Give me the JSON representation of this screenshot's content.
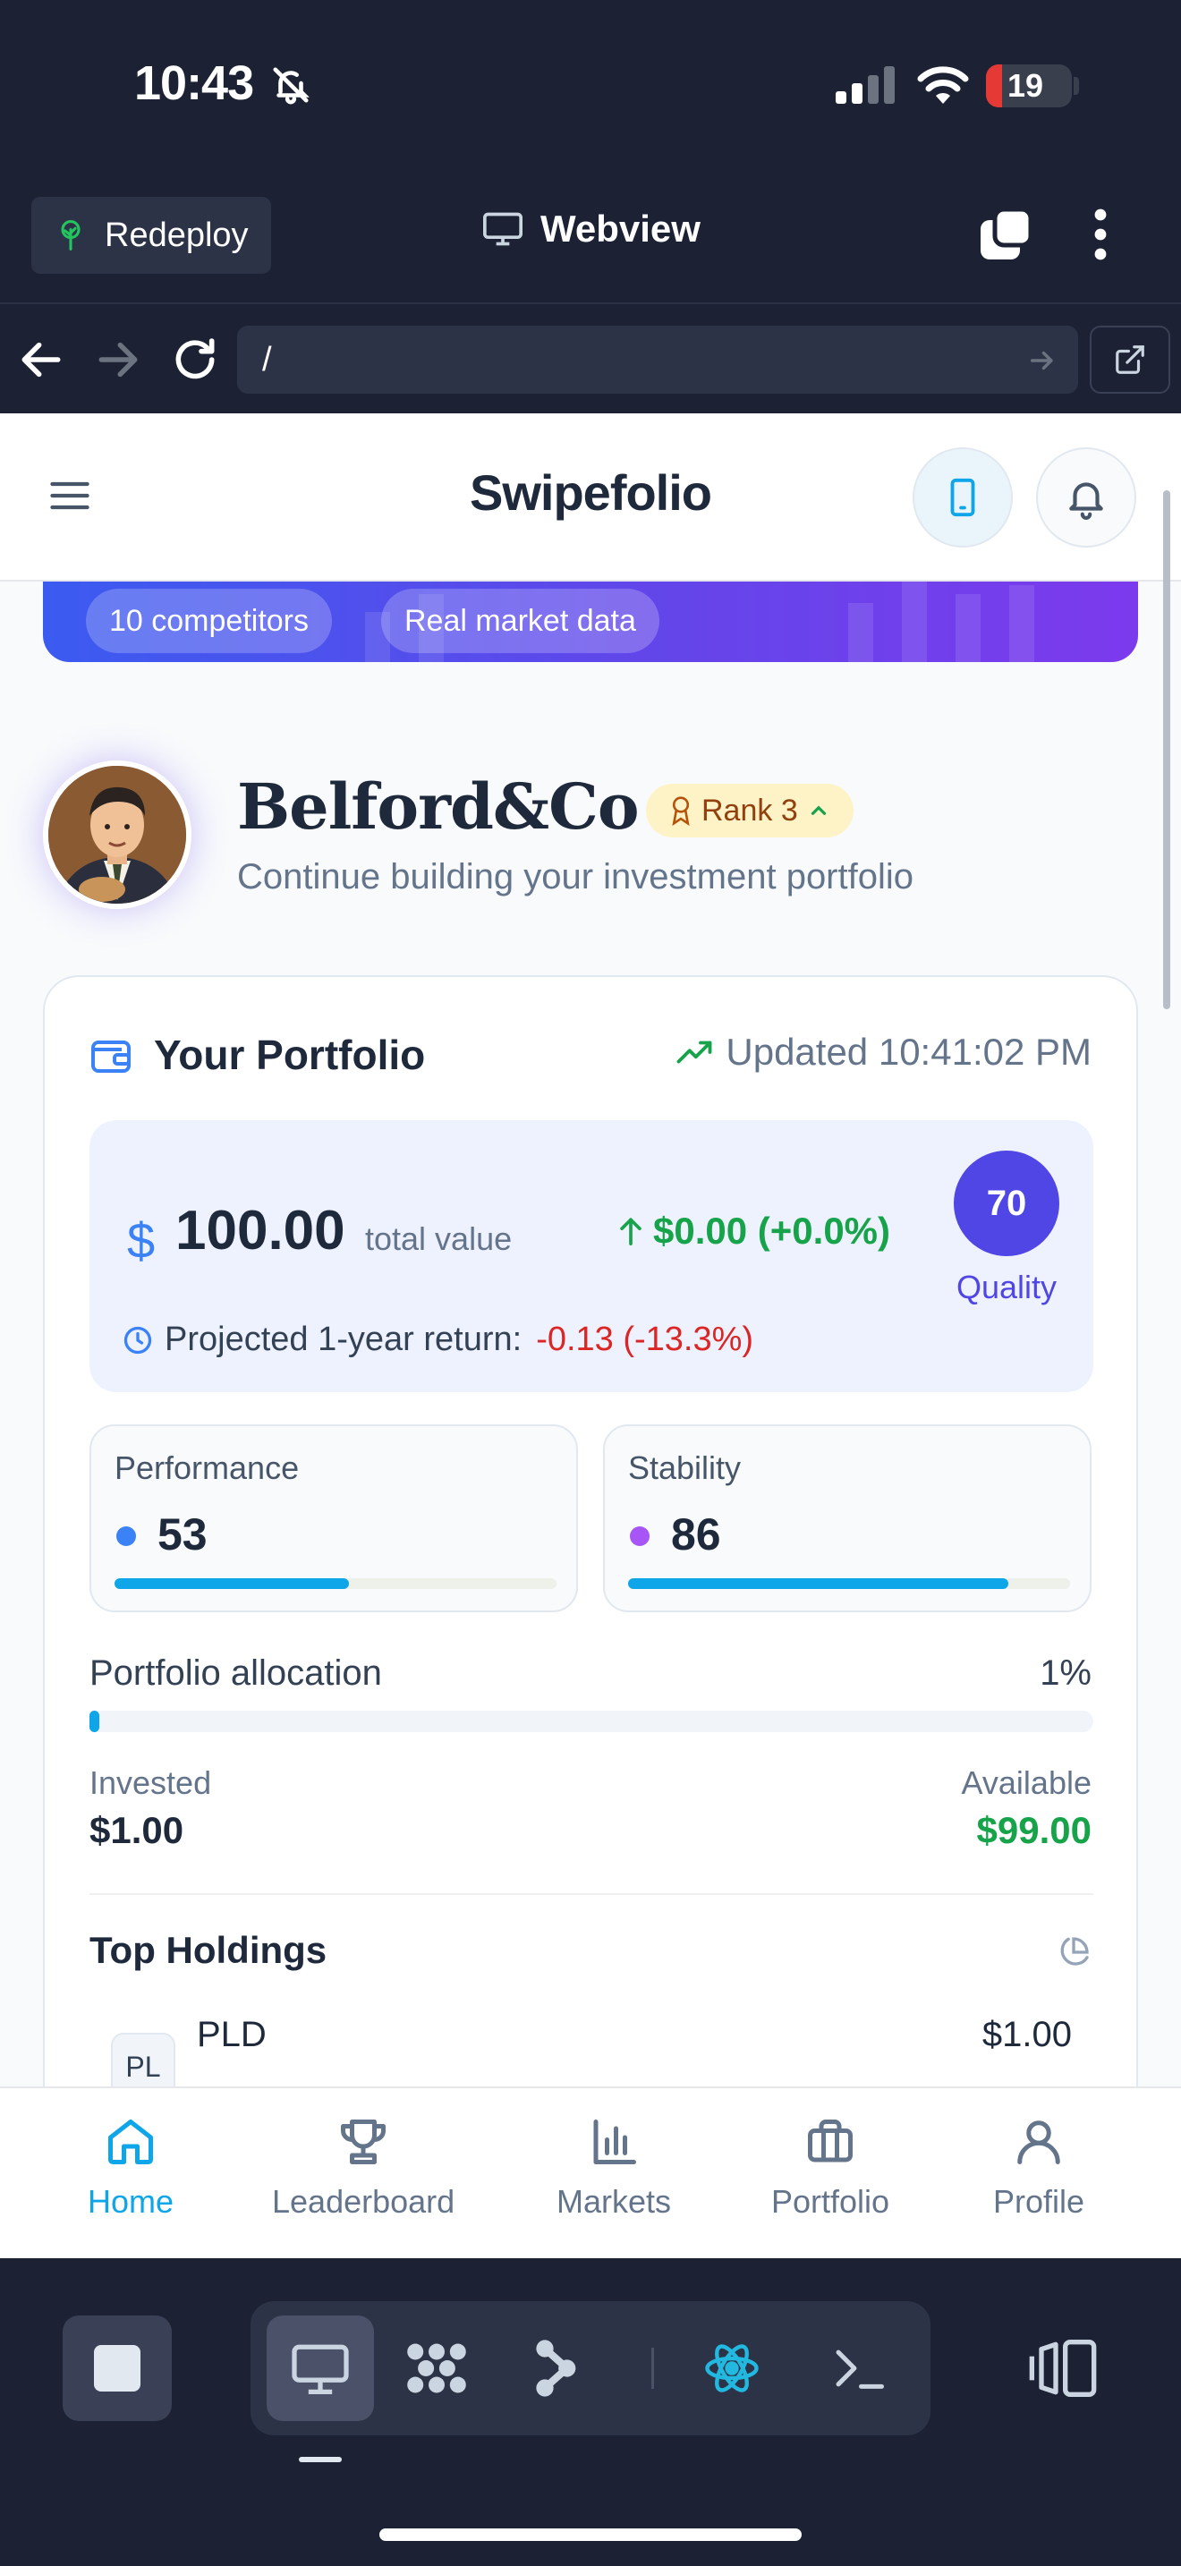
{
  "status_bar": {
    "time": "10:43",
    "battery": "19",
    "battery_level_pct": 19
  },
  "ide": {
    "redeploy_label": "Redeploy",
    "webview_label": "Webview"
  },
  "url_bar": {
    "url": "/"
  },
  "app": {
    "brand": "Swipefolio",
    "hero_chips": [
      "10 competitors",
      "Real market data"
    ],
    "user": {
      "name": "Belford&Co",
      "rank": "Rank 3",
      "subtitle": "Continue building your investment portfolio"
    },
    "portfolio": {
      "title": "Your Portfolio",
      "updated": "Updated 10:41:02 PM",
      "currency_symbol": "$",
      "total_value": "100.00",
      "total_label": "total value",
      "change": "$0.00 (+0.0%)",
      "quality_score": "70",
      "quality_label": "Quality",
      "projected_label": "Projected 1-year return:",
      "projected_value": "-0.13 (-13.3%)",
      "metrics": [
        {
          "label": "Performance",
          "value": "53",
          "dot_color": "#3b82f6",
          "bar_fraction": 0.53
        },
        {
          "label": "Stability",
          "value": "86",
          "dot_color": "#a855f7",
          "bar_fraction": 0.86
        }
      ],
      "allocation_label": "Portfolio allocation",
      "allocation_pct": "1%",
      "allocation_fraction": 0.01,
      "invested_label": "Invested",
      "invested_value": "$1.00",
      "available_label": "Available",
      "available_value": "$99.00",
      "holdings_title": "Top Holdings",
      "holdings": [
        {
          "badge": "PL",
          "symbol": "PLD",
          "value": "$1.00"
        }
      ]
    },
    "bottom_nav": [
      {
        "label": "Home",
        "icon": "home-icon",
        "active": true
      },
      {
        "label": "Leaderboard",
        "icon": "trophy-icon",
        "active": false
      },
      {
        "label": "Markets",
        "icon": "bar-chart-icon",
        "active": false
      },
      {
        "label": "Portfolio",
        "icon": "briefcase-icon",
        "active": false
      },
      {
        "label": "Profile",
        "icon": "user-icon",
        "active": false
      }
    ]
  },
  "colors": {
    "accent": "#0ea5e9",
    "brand_indigo": "#4f46e5",
    "positive": "#16a34a",
    "negative": "#dc2626",
    "chrome_bg": "#1c2133"
  }
}
